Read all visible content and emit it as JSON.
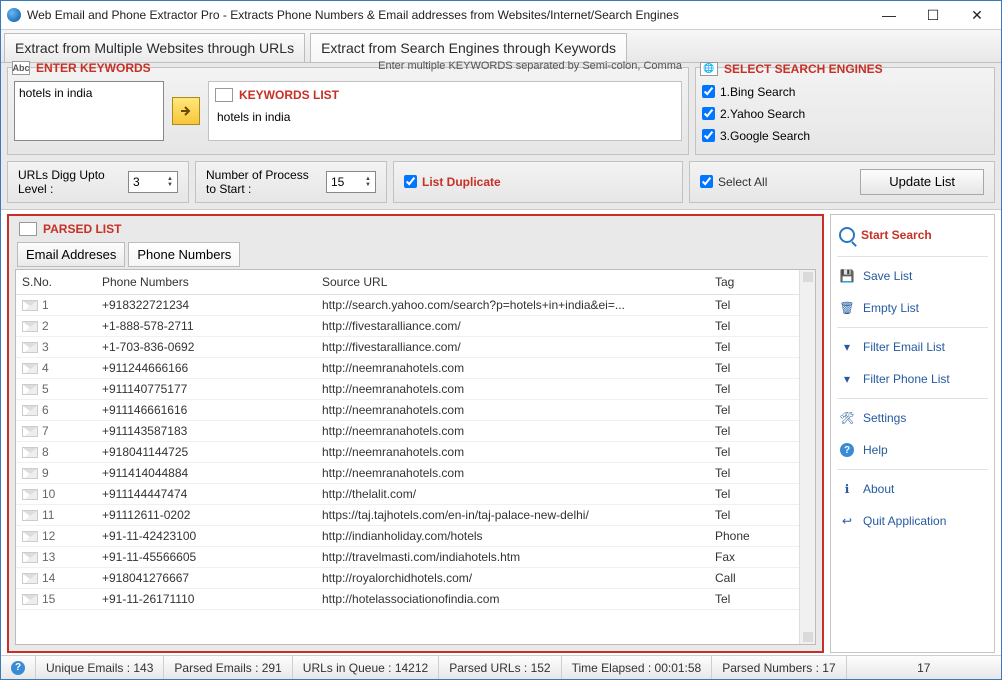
{
  "window": {
    "title": "Web Email and Phone Extractor Pro - Extracts Phone Numbers & Email addresses from Websites/Internet/Search Engines"
  },
  "tabs": {
    "urls": "Extract from Multiple Websites through URLs",
    "search": "Extract from Search Engines through Keywords"
  },
  "keywords": {
    "title": "ENTER KEYWORDS",
    "hint": "Enter multiple KEYWORDS separated by Semi-colon, Comma",
    "input": "hotels in india",
    "list_title": "KEYWORDS LIST",
    "list_value": "hotels in india"
  },
  "engines": {
    "title": "SELECT SEARCH ENGINES",
    "items": [
      "1.Bing Search",
      "2.Yahoo Search",
      "3.Google Search"
    ],
    "select_all": "Select All",
    "update": "Update List"
  },
  "options": {
    "digg_label": "URLs Digg Upto Level :",
    "digg_value": "3",
    "proc_label": "Number of Process to Start :",
    "proc_value": "15",
    "dup_label": "List Duplicate"
  },
  "parsed": {
    "title": "PARSED LIST",
    "tab_email": "Email Addreses",
    "tab_phone": "Phone Numbers",
    "cols": {
      "sno": "S.No.",
      "phone": "Phone Numbers",
      "url": "Source URL",
      "tag": "Tag"
    },
    "rows": [
      {
        "n": "1",
        "p": "+918322721234",
        "u": "http://search.yahoo.com/search?p=hotels+in+india&ei=...",
        "t": "Tel"
      },
      {
        "n": "2",
        "p": "+1-888-578-2711",
        "u": "http://fivestaralliance.com/",
        "t": "Tel"
      },
      {
        "n": "3",
        "p": "+1-703-836-0692",
        "u": "http://fivestaralliance.com/",
        "t": "Tel"
      },
      {
        "n": "4",
        "p": "+911244666166",
        "u": "http://neemranahotels.com",
        "t": "Tel"
      },
      {
        "n": "5",
        "p": "+911140775177",
        "u": "http://neemranahotels.com",
        "t": "Tel"
      },
      {
        "n": "6",
        "p": "+911146661616",
        "u": "http://neemranahotels.com",
        "t": "Tel"
      },
      {
        "n": "7",
        "p": "+911143587183",
        "u": "http://neemranahotels.com",
        "t": "Tel"
      },
      {
        "n": "8",
        "p": "+918041144725",
        "u": "http://neemranahotels.com",
        "t": "Tel"
      },
      {
        "n": "9",
        "p": "+911414044884",
        "u": "http://neemranahotels.com",
        "t": "Tel"
      },
      {
        "n": "10",
        "p": "+911144447474",
        "u": "http://thelalit.com/",
        "t": "Tel"
      },
      {
        "n": "11",
        "p": "+91112611-0202",
        "u": "https://taj.tajhotels.com/en-in/taj-palace-new-delhi/",
        "t": "Tel"
      },
      {
        "n": "12",
        "p": "+91-11-42423100",
        "u": "http://indianholiday.com/hotels",
        "t": "Phone"
      },
      {
        "n": "13",
        "p": "+91-11-45566605",
        "u": "http://travelmasti.com/indiahotels.htm",
        "t": "Fax"
      },
      {
        "n": "14",
        "p": "+918041276667",
        "u": "http://royalorchidhotels.com/",
        "t": "Call"
      },
      {
        "n": "15",
        "p": "+91-11-26171110",
        "u": "http://hotelassociationofindia.com",
        "t": "Tel"
      }
    ]
  },
  "side": {
    "start": "Start Search",
    "save": "Save List",
    "empty": "Empty List",
    "femail": "Filter Email List",
    "fphone": "Filter Phone List",
    "settings": "Settings",
    "help": "Help",
    "about": "About",
    "quit": "Quit Application"
  },
  "status": {
    "uemails": "Unique Emails :  143",
    "pemails": "Parsed Emails :   291",
    "queue": "URLs in Queue :  14212",
    "purls": "Parsed URLs :   152",
    "time": "Time Elapsed :   00:01:58",
    "pnum": "Parsed Numbers :   17",
    "right": "17"
  }
}
